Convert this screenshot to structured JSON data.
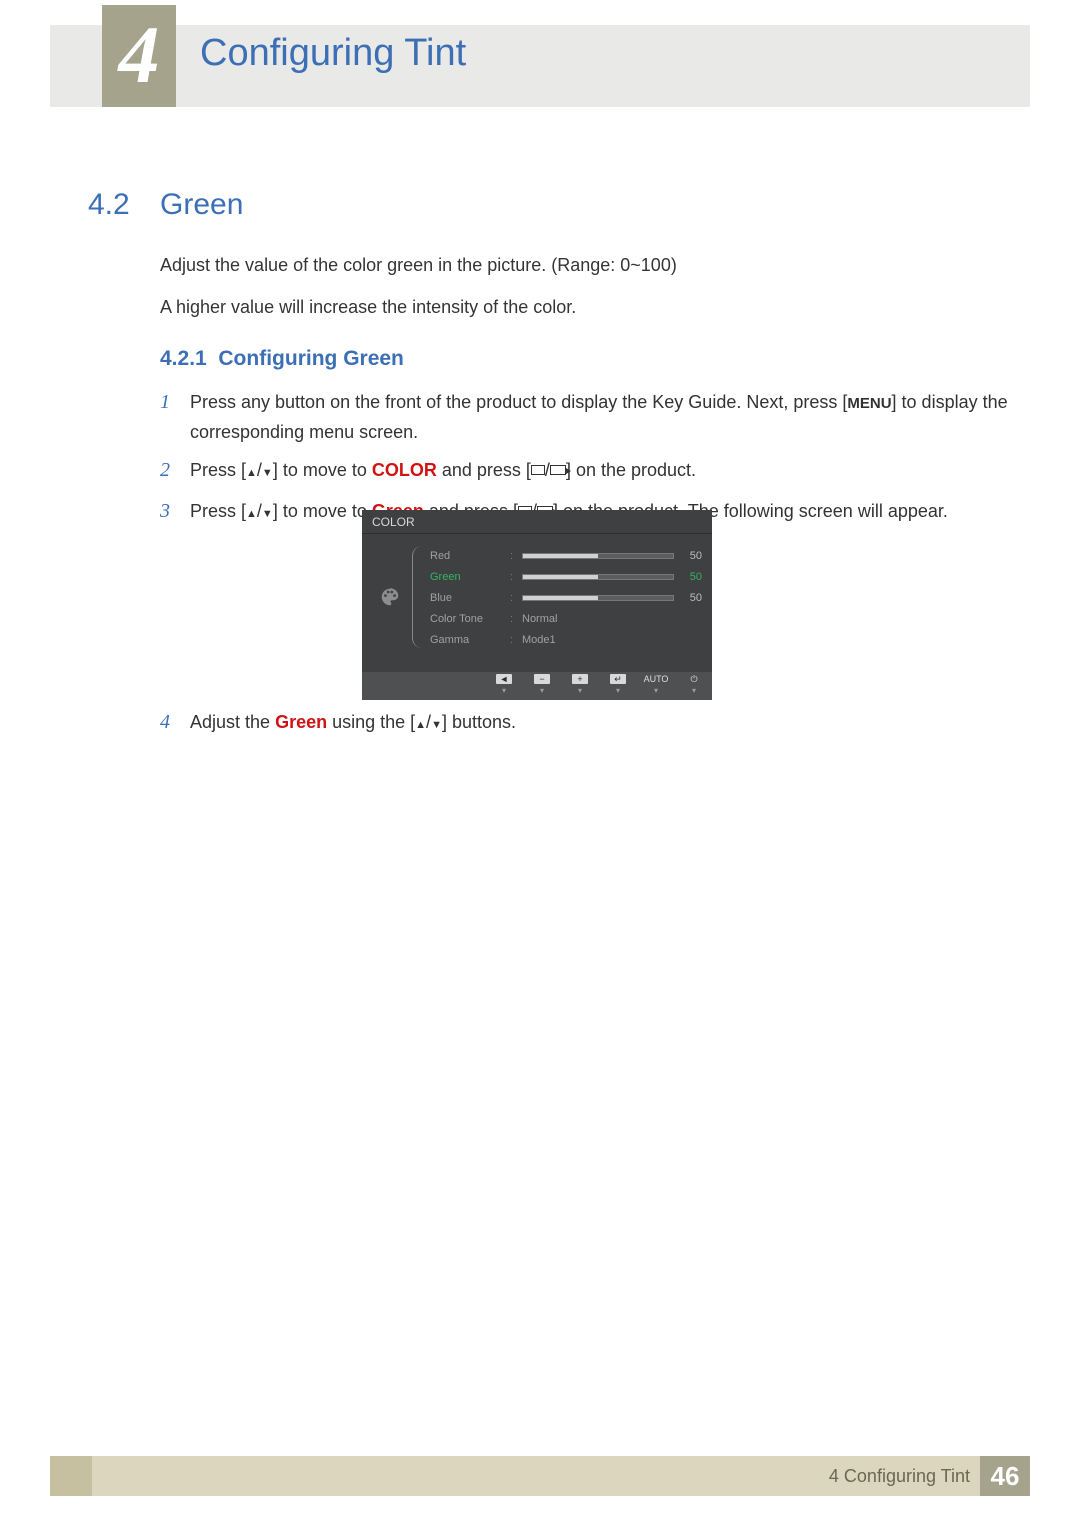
{
  "chapter": {
    "number": "4",
    "title": "Configuring Tint"
  },
  "section": {
    "number": "4.2",
    "title": "Green"
  },
  "para1": "Adjust the value of the color green in the picture. (Range: 0~100)",
  "para2": "A higher value will increase the intensity of the color.",
  "subsection": {
    "number": "4.2.1",
    "title": "Configuring Green"
  },
  "steps": {
    "s1": {
      "num": "1",
      "pre": "Press any button on the front of the product to display the Key Guide. Next, press [",
      "menu": "MENU",
      "post": "] to display the corresponding menu screen."
    },
    "s2": {
      "num": "2",
      "pre": "Press [",
      "mid": "] to move to ",
      "kw": "COLOR",
      "post1": " and press [",
      "post2": "] on the product."
    },
    "s3": {
      "num": "3",
      "pre": "Press [",
      "mid": "] to move to ",
      "kw": "Green",
      "post1": " and press [",
      "post2": "] on the product. The following screen will appear."
    },
    "s4": {
      "num": "4",
      "pre": "Adjust the ",
      "kw": "Green",
      "mid": " using the [",
      "post": "] buttons."
    }
  },
  "osd": {
    "title": "COLOR",
    "rows": {
      "red": {
        "label": "Red",
        "value": "50"
      },
      "green": {
        "label": "Green",
        "value": "50"
      },
      "blue": {
        "label": "Blue",
        "value": "50"
      },
      "tone": {
        "label": "Color Tone",
        "value": "Normal"
      },
      "gamma": {
        "label": "Gamma",
        "value": "Mode1"
      }
    },
    "footer": {
      "auto": "AUTO"
    }
  },
  "footer": {
    "chapterLabel": "4 Configuring Tint",
    "page": "46"
  }
}
